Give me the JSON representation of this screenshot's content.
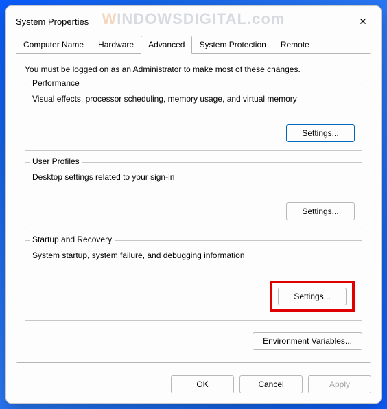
{
  "watermark": "WINDOWSDIGITAL.com",
  "window": {
    "title": "System Properties",
    "close_label": "✕"
  },
  "tabs": [
    {
      "label": "Computer Name"
    },
    {
      "label": "Hardware"
    },
    {
      "label": "Advanced"
    },
    {
      "label": "System Protection"
    },
    {
      "label": "Remote"
    }
  ],
  "advanced": {
    "admin_note": "You must be logged on as an Administrator to make most of these changes.",
    "performance": {
      "legend": "Performance",
      "desc": "Visual effects, processor scheduling, memory usage, and virtual memory",
      "button": "Settings..."
    },
    "user_profiles": {
      "legend": "User Profiles",
      "desc": "Desktop settings related to your sign-in",
      "button": "Settings..."
    },
    "startup_recovery": {
      "legend": "Startup and Recovery",
      "desc": "System startup, system failure, and debugging information",
      "button": "Settings..."
    },
    "env_button": "Environment Variables..."
  },
  "footer": {
    "ok": "OK",
    "cancel": "Cancel",
    "apply": "Apply"
  }
}
